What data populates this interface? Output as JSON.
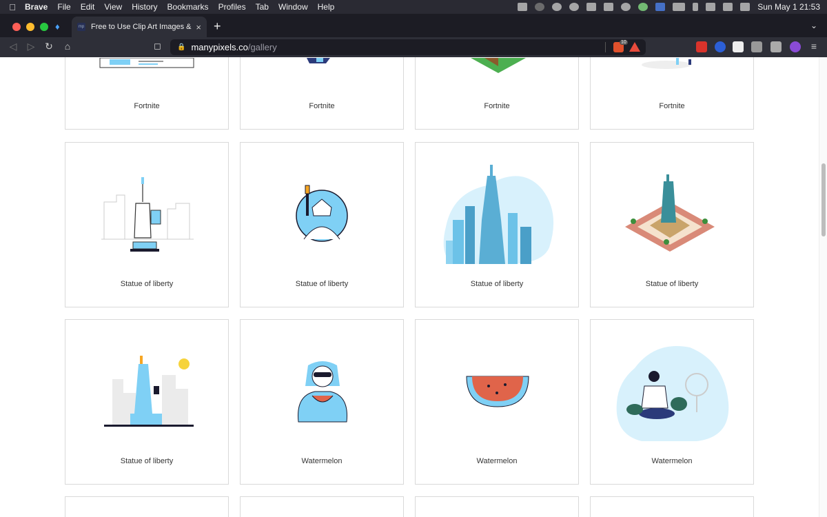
{
  "menubar": {
    "apple": "",
    "items": [
      "Brave",
      "File",
      "Edit",
      "View",
      "History",
      "Bookmarks",
      "Profiles",
      "Tab",
      "Window",
      "Help"
    ],
    "clock": "Sun May 1  21:53"
  },
  "tab": {
    "title": "Free to Use Clip Art Images & V",
    "favicon_text": "mp",
    "close": "×"
  },
  "newtab": "+",
  "url": {
    "host": "manypixels.co",
    "path": "/gallery"
  },
  "shields_count": "10",
  "gallery": {
    "row1": [
      "Fortnite",
      "Fortnite",
      "Fortnite",
      "Fortnite"
    ],
    "row2": [
      "Statue of liberty",
      "Statue of liberty",
      "Statue of liberty",
      "Statue of liberty"
    ],
    "row3": [
      "Statue of liberty",
      "Watermelon",
      "Watermelon",
      "Watermelon"
    ]
  },
  "colors": {
    "accent": "#7fd0f5",
    "watermelon": "#e0644a",
    "sun": "#f6d33c"
  }
}
